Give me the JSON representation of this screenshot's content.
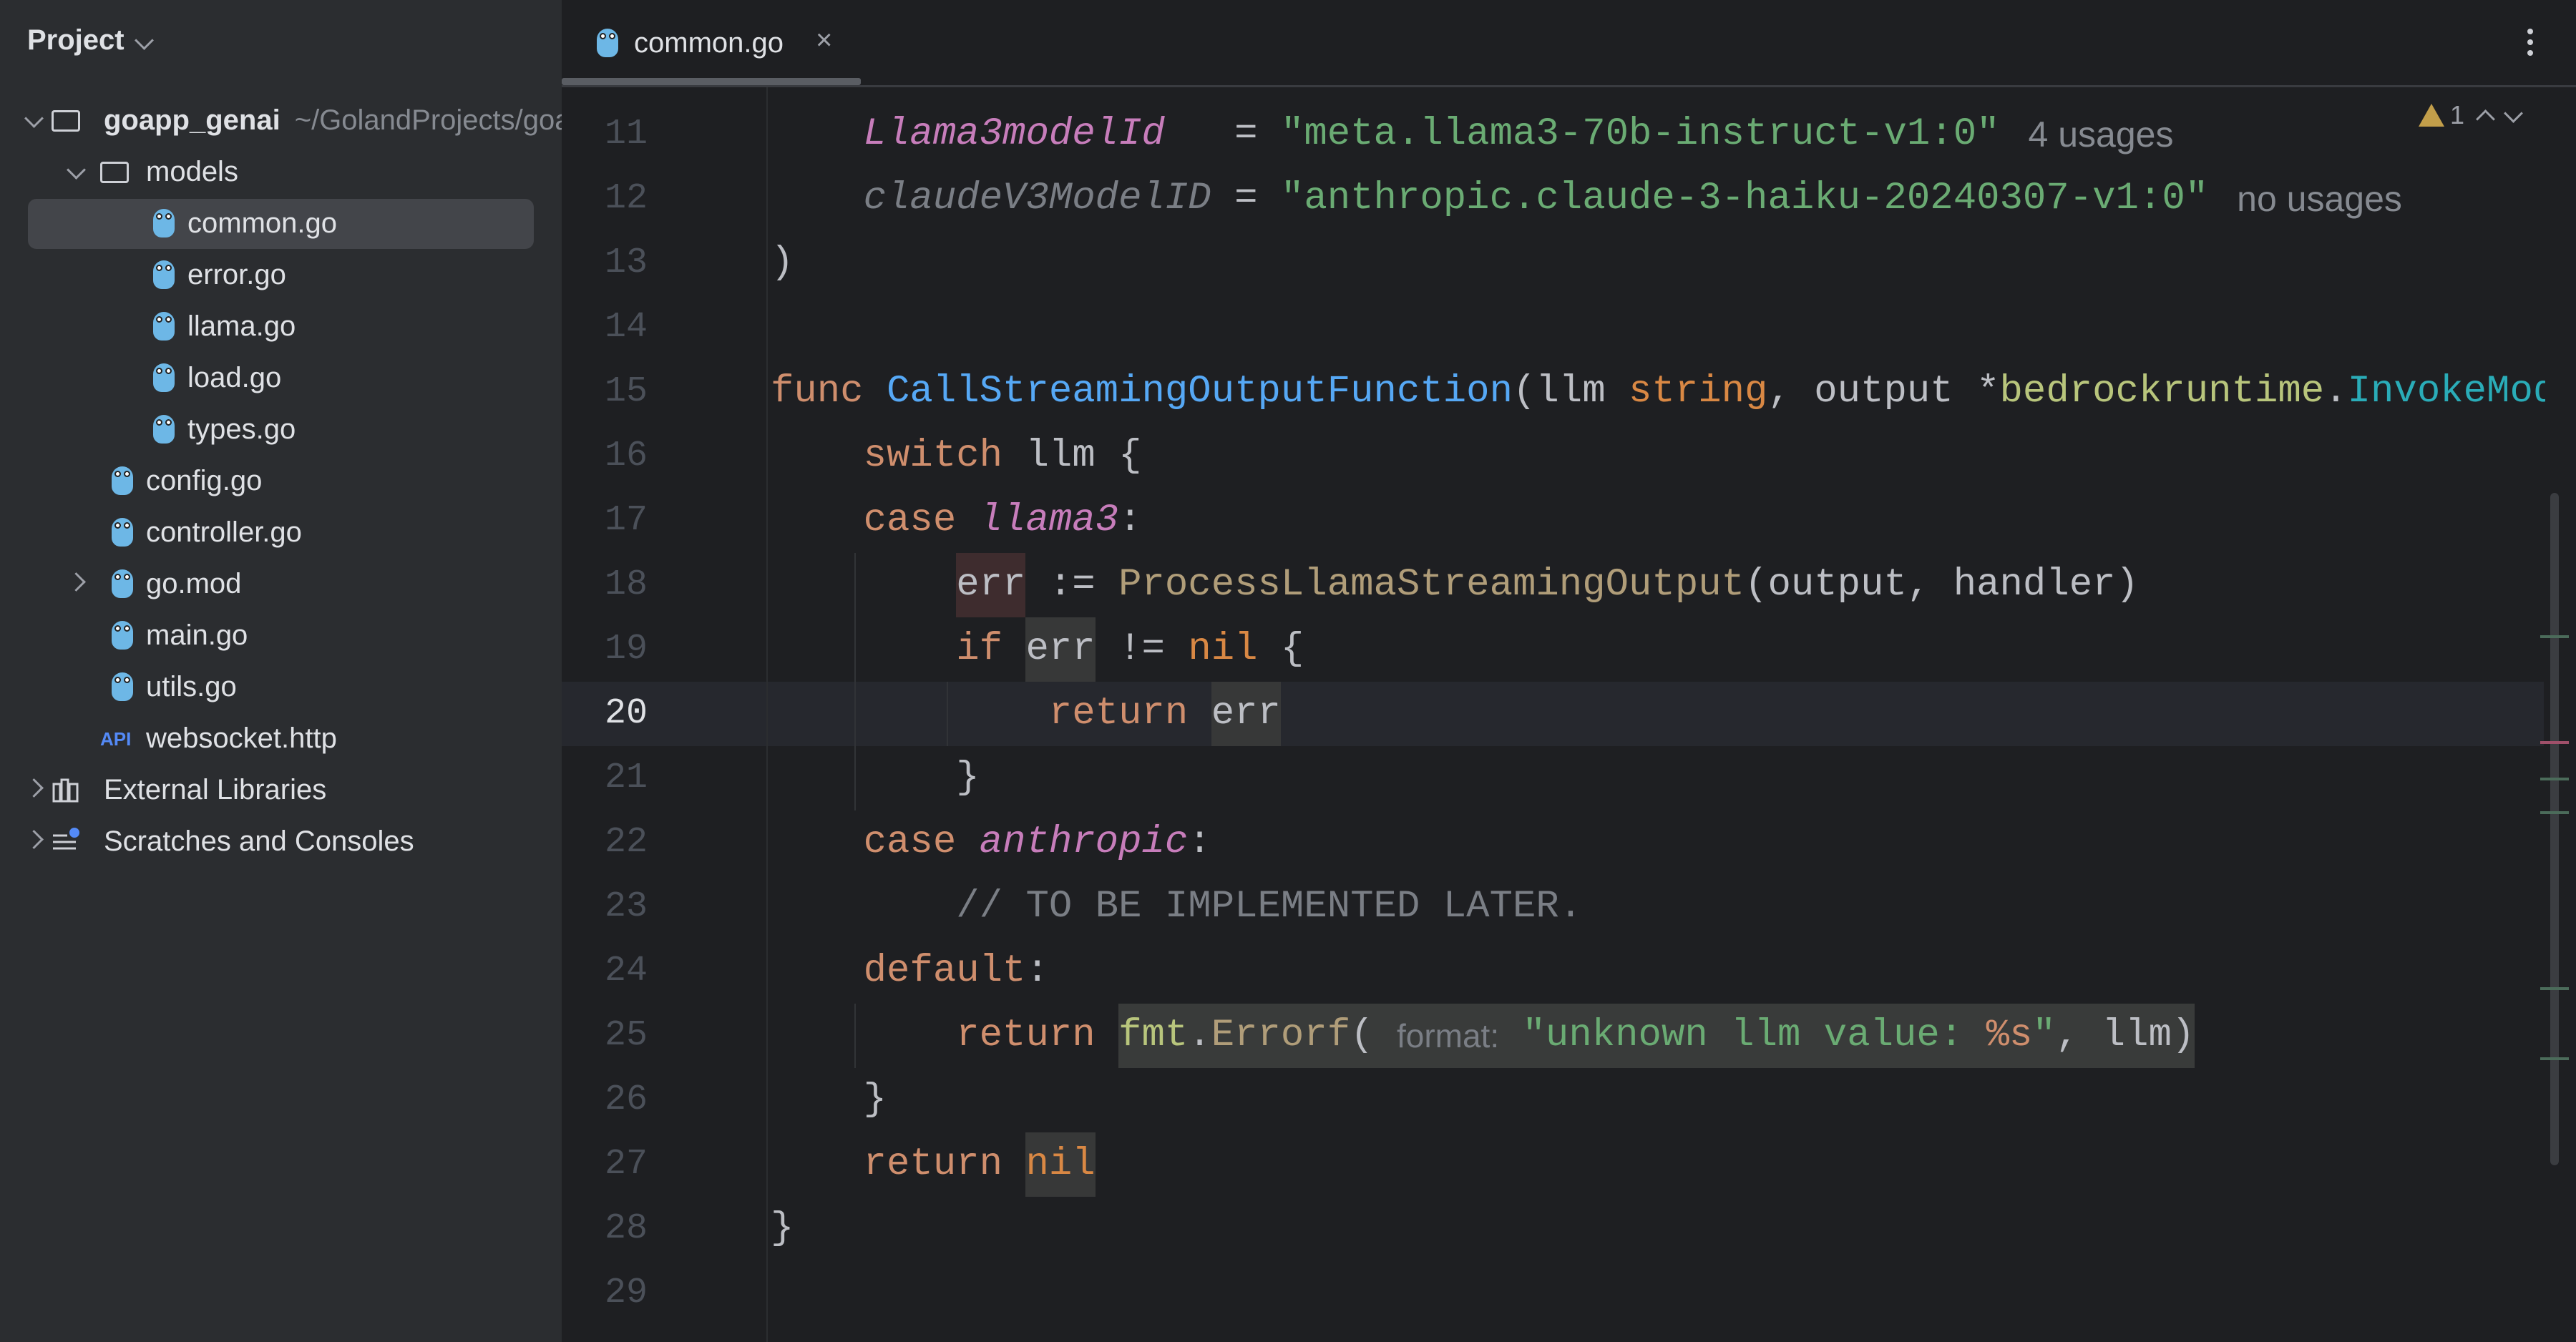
{
  "sidebar": {
    "title": "Project",
    "items": [
      {
        "label": "goapp_genai",
        "path": "~/GolandProjects/goapp_genai",
        "icon": "folder-icon",
        "depth": 0,
        "chevron": "down"
      },
      {
        "label": "models",
        "icon": "folder-icon",
        "depth": 1,
        "chevron": "down"
      },
      {
        "label": "common.go",
        "icon": "go-file-icon",
        "depth": 2,
        "selected": true
      },
      {
        "label": "error.go",
        "icon": "go-file-icon",
        "depth": 2
      },
      {
        "label": "llama.go",
        "icon": "go-file-icon",
        "depth": 2
      },
      {
        "label": "load.go",
        "icon": "go-file-icon",
        "depth": 2
      },
      {
        "label": "types.go",
        "icon": "go-file-icon",
        "depth": 2
      },
      {
        "label": "config.go",
        "icon": "go-file-icon",
        "depth": 1
      },
      {
        "label": "controller.go",
        "icon": "go-file-icon",
        "depth": 1
      },
      {
        "label": "go.mod",
        "icon": "go-mod-icon",
        "depth": 1,
        "chevron": "right"
      },
      {
        "label": "main.go",
        "icon": "go-file-icon",
        "depth": 1
      },
      {
        "label": "utils.go",
        "icon": "go-file-icon",
        "depth": 1
      },
      {
        "label": "websocket.http",
        "icon": "api-icon",
        "depth": 1
      },
      {
        "label": "External Libraries",
        "icon": "library-icon",
        "depth": 0,
        "chevron": "right"
      },
      {
        "label": "Scratches and Consoles",
        "icon": "scratches-icon",
        "depth": 0,
        "chevron": "right"
      }
    ]
  },
  "tab": {
    "label": "common.go",
    "close": "×"
  },
  "inspections": {
    "warnings": "1"
  },
  "editor": {
    "current_line": 20,
    "lines": [
      {
        "n": "11",
        "tokens": [
          {
            "t": "    "
          },
          {
            "t": "Llama3modelId",
            "c": "cst"
          },
          {
            "t": "   = "
          },
          {
            "t": "\"meta.llama3-70b-instruct-v1:0\"",
            "c": "str"
          },
          {
            "t": "4 usages",
            "c": "hint"
          }
        ]
      },
      {
        "n": "12",
        "tokens": [
          {
            "t": "    "
          },
          {
            "t": "claudeV3ModelID",
            "c": "unused"
          },
          {
            "t": " = "
          },
          {
            "t": "\"anthropic.claude-3-haiku-20240307-v1:0\"",
            "c": "str"
          },
          {
            "t": "no usages",
            "c": "hint"
          }
        ]
      },
      {
        "n": "13",
        "tokens": [
          {
            "t": ")"
          }
        ]
      },
      {
        "n": "14",
        "tokens": []
      },
      {
        "n": "15",
        "tokens": [
          {
            "t": "func",
            "c": "kw"
          },
          {
            "t": " "
          },
          {
            "t": "CallStreamingOutputFunction",
            "c": "fn"
          },
          {
            "t": "(llm "
          },
          {
            "t": "string",
            "c": "ty"
          },
          {
            "t": ", output *"
          },
          {
            "t": "bedrockruntime",
            "c": "pkg"
          },
          {
            "t": "."
          },
          {
            "t": "InvokeMode",
            "c": "teal"
          }
        ]
      },
      {
        "n": "16",
        "tokens": [
          {
            "t": "    "
          },
          {
            "t": "switch",
            "c": "kw"
          },
          {
            "t": " llm {"
          }
        ]
      },
      {
        "n": "17",
        "tokens": [
          {
            "t": "    "
          },
          {
            "t": "case",
            "c": "kw"
          },
          {
            "t": " "
          },
          {
            "t": "llama3",
            "c": "cst"
          },
          {
            "t": ":"
          }
        ]
      },
      {
        "n": "18",
        "tokens": [
          {
            "t": "        "
          },
          {
            "t": "err",
            "c": "hw"
          },
          {
            "t": " := "
          },
          {
            "t": "ProcessLlamaStreamingOutput",
            "c": "call"
          },
          {
            "t": "(output, handler)"
          }
        ]
      },
      {
        "n": "19",
        "tokens": [
          {
            "t": "        "
          },
          {
            "t": "if",
            "c": "kw"
          },
          {
            "t": " "
          },
          {
            "t": "err",
            "c": "hr"
          },
          {
            "t": " != "
          },
          {
            "t": "nil",
            "c": "nil"
          },
          {
            "t": " {"
          }
        ]
      },
      {
        "n": "20",
        "tokens": [
          {
            "t": "            "
          },
          {
            "t": "return",
            "c": "kw"
          },
          {
            "t": " "
          },
          {
            "t": "err",
            "c": "hr"
          }
        ]
      },
      {
        "n": "21",
        "tokens": [
          {
            "t": "        }"
          }
        ]
      },
      {
        "n": "22",
        "tokens": [
          {
            "t": "    "
          },
          {
            "t": "case",
            "c": "kw"
          },
          {
            "t": " "
          },
          {
            "t": "anthropic",
            "c": "cst"
          },
          {
            "t": ":"
          }
        ]
      },
      {
        "n": "23",
        "tokens": [
          {
            "t": "        "
          },
          {
            "t": "// TO BE IMPLEMENTED LATER.",
            "c": "cm"
          }
        ]
      },
      {
        "n": "24",
        "tokens": [
          {
            "t": "    "
          },
          {
            "t": "default",
            "c": "kw"
          },
          {
            "t": ":"
          }
        ]
      },
      {
        "n": "25",
        "tokens": [
          {
            "t": "        "
          },
          {
            "t": "return",
            "c": "kw"
          },
          {
            "t": " "
          },
          {
            "t": "fmt",
            "c": "pkg hc"
          },
          {
            "t": ".",
            "c": "hc"
          },
          {
            "t": "Errorf",
            "c": "call hc"
          },
          {
            "t": "( ",
            "c": "hc"
          },
          {
            "t": "format:",
            "c": "inlay hc"
          },
          {
            "t": " ",
            "c": "hc"
          },
          {
            "t": "\"unknown llm value: ",
            "c": "str hc"
          },
          {
            "t": "%s",
            "c": "esc hc"
          },
          {
            "t": "\"",
            "c": "str hc"
          },
          {
            "t": ", llm)",
            "c": "hc"
          }
        ]
      },
      {
        "n": "26",
        "tokens": [
          {
            "t": "    }"
          }
        ]
      },
      {
        "n": "27",
        "tokens": [
          {
            "t": "    "
          },
          {
            "t": "return",
            "c": "kw"
          },
          {
            "t": " "
          },
          {
            "t": "nil",
            "c": "nil hr"
          }
        ]
      },
      {
        "n": "28",
        "tokens": [
          {
            "t": "}"
          }
        ]
      },
      {
        "n": "29",
        "tokens": []
      }
    ]
  },
  "colors": {
    "sidebar_bg": "#2b2d30",
    "editor_bg": "#1e1f22",
    "keyword": "#cf8e6d",
    "function": "#56a8f5",
    "string": "#6aab73",
    "constant": "#c77dbb",
    "warning": "#c29e4a"
  }
}
